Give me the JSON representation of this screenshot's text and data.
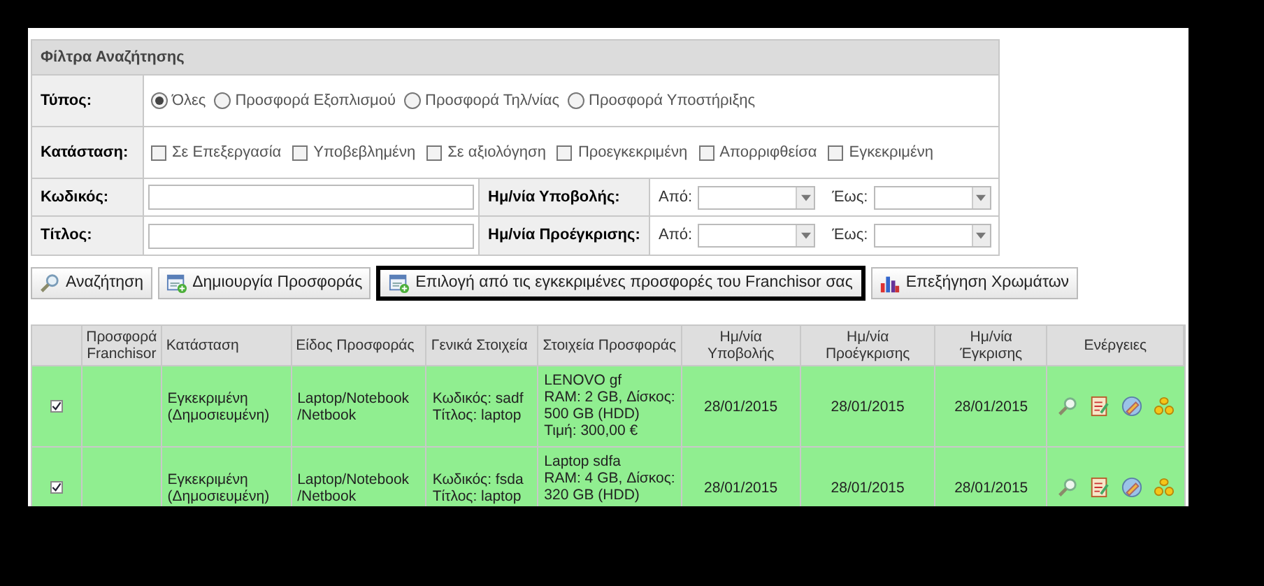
{
  "filters": {
    "title": "Φίλτρα Αναζήτησης",
    "type": {
      "label": "Τύπος:",
      "options": [
        {
          "label": "Όλες",
          "selected": true
        },
        {
          "label": "Προσφορά Εξοπλισμού",
          "selected": false
        },
        {
          "label": "Προσφορά Τηλ/νίας",
          "selected": false
        },
        {
          "label": "Προσφορά Υποστήριξης",
          "selected": false
        }
      ]
    },
    "status": {
      "label": "Κατάσταση:",
      "options": [
        {
          "label": "Σε Επεξεργασία",
          "checked": false
        },
        {
          "label": "Υποβεβλημένη",
          "checked": false
        },
        {
          "label": "Σε αξιολόγηση",
          "checked": false
        },
        {
          "label": "Προεγκεκριμένη",
          "checked": false
        },
        {
          "label": "Απορριφθείσα",
          "checked": false
        },
        {
          "label": "Εγκεκριμένη",
          "checked": false
        }
      ]
    },
    "text_fields": [
      {
        "label": "Κωδικός:",
        "date_label": "Ημ/νία Υποβολής:",
        "from": "Από:",
        "to": "Έως:"
      },
      {
        "label": "Τίτλος:",
        "date_label": "Ημ/νία Προέγκρισης:",
        "from": "Από:",
        "to": "Έως:"
      }
    ]
  },
  "buttons": [
    {
      "label": "Αναζήτηση",
      "kind": "search",
      "highlighted": false
    },
    {
      "label": "Δημιουργία Προσφοράς",
      "kind": "create",
      "highlighted": false
    },
    {
      "label": "Επιλογή από τις εγκεκριμένες προσφορές του Franchisor σας",
      "kind": "create",
      "highlighted": true
    },
    {
      "label": "Επεξήγηση Χρωμάτων",
      "kind": "legend",
      "highlighted": false
    }
  ],
  "table": {
    "columns": [
      "Προσφορά Franchisor",
      "Κατάσταση",
      "Είδος Προσφοράς",
      "Γενικά Στοιχεία",
      "Στοιχεία Προσφοράς",
      "Ημ/νία Υποβολής",
      "Ημ/νία Προέγκρισης",
      "Ημ/νία Έγκρισης",
      "Ενέργειες"
    ],
    "rows": [
      {
        "checked": true,
        "status": [
          "Εγκεκριμένη",
          "(Δημοσιευμένη)"
        ],
        "offer_type": [
          "Laptop/Notebook",
          "/Netbook"
        ],
        "general": [
          "Κωδικός: sadf",
          "Τίτλος: laptop"
        ],
        "details": [
          "LENOVO gf",
          "RAM: 2 GB, Δίσκος:",
          "500 GB (HDD)",
          "Τιμή: 300,00 €"
        ],
        "submitted": "28/01/2015",
        "preapproved": "28/01/2015",
        "approved": "28/01/2015"
      },
      {
        "checked": true,
        "status": [
          "Εγκεκριμένη",
          "(Δημοσιευμένη)"
        ],
        "offer_type": [
          "Laptop/Notebook",
          "/Netbook"
        ],
        "general": [
          "Κωδικός: fsda",
          "Τίτλος: laptop"
        ],
        "details": [
          "Laptop sdfa",
          "RAM: 4 GB, Δίσκος:",
          "320 GB (HDD)"
        ],
        "submitted": "28/01/2015",
        "preapproved": "28/01/2015",
        "approved": "28/01/2015"
      }
    ]
  }
}
